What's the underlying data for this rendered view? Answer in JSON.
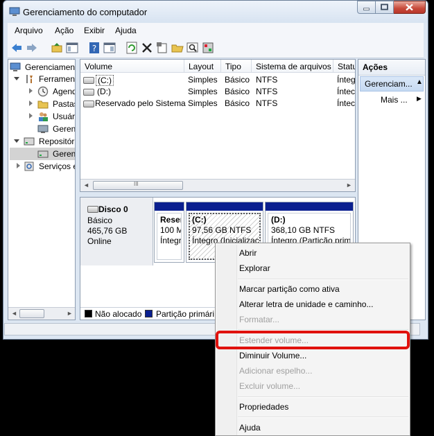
{
  "window": {
    "title": "Gerenciamento do computador"
  },
  "menu": [
    "Arquivo",
    "Ação",
    "Exibir",
    "Ajuda"
  ],
  "toolbar_icons": [
    "back-arrow-icon",
    "forward-arrow-icon",
    "up-folder-icon",
    "show-hide-tree-icon",
    "help-icon",
    "properties-view-icon",
    "refresh-icon",
    "delete-icon",
    "properties-icon",
    "open-icon",
    "search-icon",
    "rescan-icon"
  ],
  "tree": {
    "root": "Gerenciament",
    "tools": "Ferrament",
    "tools_children": [
      "Agend",
      "Pastas",
      "Usuári",
      "Gerenc"
    ],
    "storage": "Repositór",
    "storage_children": [
      "Gerenc"
    ],
    "services": "Serviços e"
  },
  "list": {
    "columns": [
      "Volume",
      "Layout",
      "Tipo",
      "Sistema de arquivos",
      "Statu"
    ],
    "rows": [
      {
        "volume": "(C:)",
        "layout": "Simples",
        "tipo": "Básico",
        "fs": "NTFS",
        "status": "Ínteg"
      },
      {
        "volume": "(D:)",
        "layout": "Simples",
        "tipo": "Básico",
        "fs": "NTFS",
        "status": "Íntec"
      },
      {
        "volume": "Reservado pelo Sistema",
        "layout": "Simples",
        "tipo": "Básico",
        "fs": "NTFS",
        "status": "Íntec"
      }
    ],
    "scroll_grip": "III"
  },
  "disk": {
    "name": "Disco 0",
    "type": "Básico",
    "size": "465,76 GB",
    "state": "Online",
    "partitions": [
      {
        "title": "Reser",
        "line1": "100 M",
        "line2": "Íntegr"
      },
      {
        "title": "(C:)",
        "line1": "97,56 GB NTFS",
        "line2": "Íntegro (Inicializaç"
      },
      {
        "title": "(D:)",
        "line1": "368,10 GB NTFS",
        "line2": "Íntegro (Partição prim"
      }
    ],
    "legend": [
      {
        "label": "Não alocado",
        "color": "#000000"
      },
      {
        "label": "Partição primári",
        "color": "#0a1f8f"
      }
    ]
  },
  "actions": {
    "header": "Ações",
    "selected": "Gerenciam...",
    "more": "Mais ..."
  },
  "context_menu": {
    "items": [
      {
        "label": "Abrir",
        "enabled": true
      },
      {
        "label": "Explorar",
        "enabled": true
      },
      {
        "label": "Marcar partição como ativa",
        "enabled": true
      },
      {
        "label": "Alterar letra de unidade e caminho...",
        "enabled": true
      },
      {
        "label": "Formatar...",
        "enabled": false
      },
      {
        "label": "Estender volume...",
        "enabled": false
      },
      {
        "label": "Diminuir Volume...",
        "enabled": true
      },
      {
        "label": "Adicionar espelho...",
        "enabled": false
      },
      {
        "label": "Excluir volume...",
        "enabled": false
      },
      {
        "label": "Propriedades",
        "enabled": true
      },
      {
        "label": "Ajuda",
        "enabled": true
      }
    ],
    "highlight_color": "#e0110d"
  }
}
